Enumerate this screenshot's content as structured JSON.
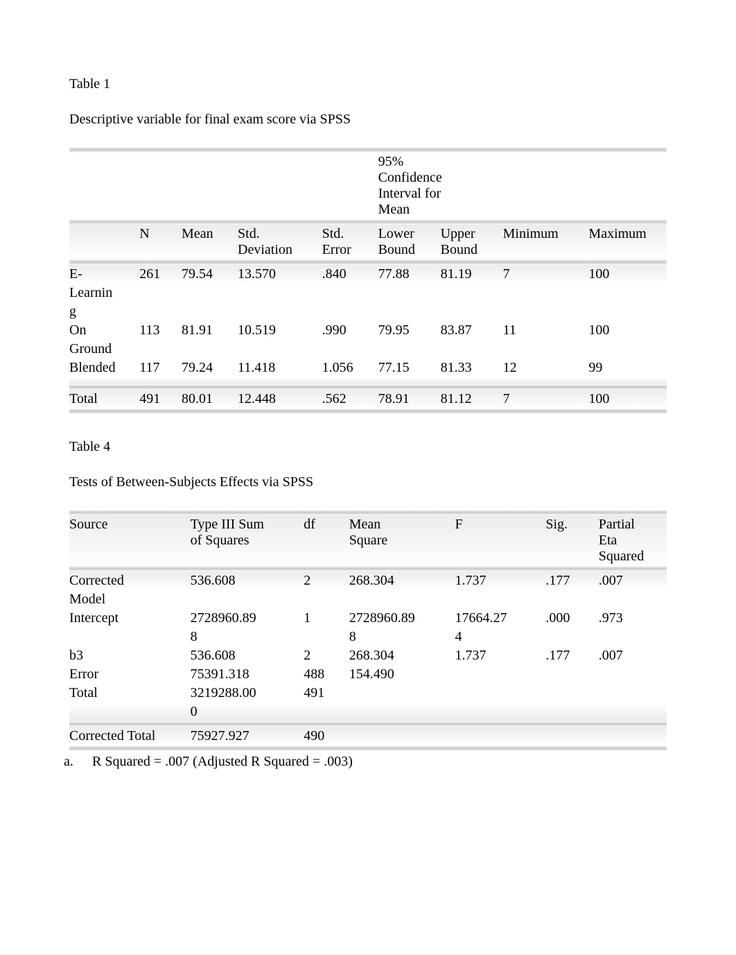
{
  "table1": {
    "title": "Table 1",
    "caption": "Descriptive variable for final exam score via SPSS",
    "ci_header_lines": [
      "95%",
      "Confidence",
      "Interval for",
      "Mean"
    ],
    "headers": {
      "col0": "",
      "n": "N",
      "mean": "Mean",
      "std_dev_l1": "Std.",
      "std_dev_l2": "Deviation",
      "std_err_l1": "Std.",
      "std_err_l2": "Error",
      "lower_l1": "Lower",
      "lower_l2": "Bound",
      "upper_l1": "Upper",
      "upper_l2": "Bound",
      "min": "Minimum",
      "max": "Maximum"
    },
    "rows": [
      {
        "label_l1": "E-",
        "label_l2": "Learnin",
        "label_l3": "g",
        "n": "261",
        "mean": "79.54",
        "sd": "13.570",
        "se": ".840",
        "lb": "77.88",
        "ub": "81.19",
        "min": "7",
        "max": "100"
      },
      {
        "label_l1": "On",
        "label_l2": "Ground",
        "label_l3": "",
        "n": "113",
        "mean": "81.91",
        "sd": "10.519",
        "se": ".990",
        "lb": "79.95",
        "ub": "83.87",
        "min": "11",
        "max": "100"
      },
      {
        "label_l1": "Blended",
        "label_l2": "",
        "label_l3": "",
        "n": "117",
        "mean": "79.24",
        "sd": "11.418",
        "se": "1.056",
        "lb": "77.15",
        "ub": "81.33",
        "min": "12",
        "max": "99"
      }
    ],
    "total": {
      "label": "Total",
      "n": "491",
      "mean": "80.01",
      "sd": "12.448",
      "se": ".562",
      "lb": "78.91",
      "ub": "81.12",
      "min": "7",
      "max": "100"
    }
  },
  "table4": {
    "title": "Table 4",
    "caption": "Tests of Between-Subjects Effects via SPSS",
    "headers": {
      "source": "Source",
      "ss_l1": "Type III Sum",
      "ss_l2": "of Squares",
      "df": "df",
      "ms_l1": "Mean",
      "ms_l2": "Square",
      "f": "F",
      "sig": "Sig.",
      "pes_l1": "Partial",
      "pes_l2": "Eta",
      "pes_l3": "Squared"
    },
    "rows": [
      {
        "source_l1": "Corrected",
        "source_l2": "Model",
        "ss": "536.608",
        "ss2": "",
        "df": "2",
        "ms": "268.304",
        "ms2": "",
        "f": "1.737",
        "f2": "",
        "sig": ".177",
        "pes": ".007"
      },
      {
        "source_l1": "Intercept",
        "source_l2": "",
        "ss": "2728960.89",
        "ss2": "8",
        "df": "1",
        "ms": "2728960.89",
        "ms2": "8",
        "f": "17664.27",
        "f2": "4",
        "sig": ".000",
        "pes": ".973"
      },
      {
        "source_l1": "b3",
        "source_l2": "",
        "ss": "536.608",
        "ss2": "",
        "df": "2",
        "ms": "268.304",
        "ms2": "",
        "f": "1.737",
        "f2": "",
        "sig": ".177",
        "pes": ".007"
      },
      {
        "source_l1": "Error",
        "source_l2": "",
        "ss": "75391.318",
        "ss2": "",
        "df": "488",
        "ms": "154.490",
        "ms2": "",
        "f": "",
        "f2": "",
        "sig": "",
        "pes": ""
      },
      {
        "source_l1": "Total",
        "source_l2": "",
        "ss": "3219288.00",
        "ss2": "0",
        "df": "491",
        "ms": "",
        "ms2": "",
        "f": "",
        "f2": "",
        "sig": "",
        "pes": ""
      }
    ],
    "corrected_total": {
      "label": "Corrected Total",
      "ss": "75927.927",
      "df": "490"
    },
    "footnote": {
      "marker": "a.",
      "text": "R Squared = .007 (Adjusted R Squared = .003)"
    }
  }
}
